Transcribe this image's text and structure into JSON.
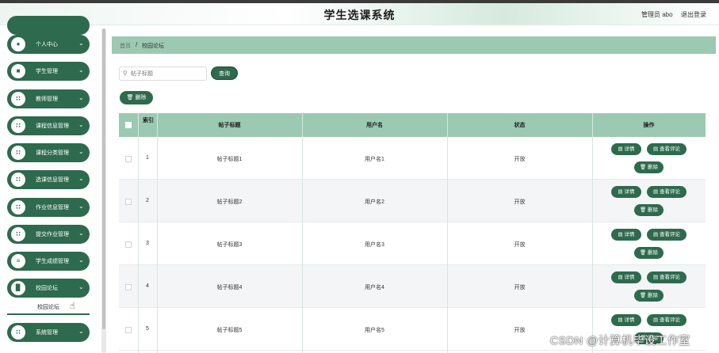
{
  "header": {
    "title": "学生选课系统",
    "admin_label": "管理员 abo",
    "logout_label": "退出登录"
  },
  "sidebar": {
    "items": [
      {
        "label": "个人中心",
        "icon": "user-icon"
      },
      {
        "label": "学生管理",
        "icon": "document-icon"
      },
      {
        "label": "教师管理",
        "icon": "grid-icon"
      },
      {
        "label": "课程信息管理",
        "icon": "grid-icon"
      },
      {
        "label": "课程分类管理",
        "icon": "grid-icon"
      },
      {
        "label": "选课信息管理",
        "icon": "grid-icon"
      },
      {
        "label": "作业信息管理",
        "icon": "grid-icon"
      },
      {
        "label": "提交作业管理",
        "icon": "grid-icon"
      },
      {
        "label": "学生成绩管理",
        "icon": "list-icon"
      },
      {
        "label": "校园论坛",
        "icon": "bar-chart-icon"
      },
      {
        "label": "系统管理",
        "icon": "grid-icon"
      }
    ],
    "subitem": "校园论坛"
  },
  "breadcrumb": {
    "home": "首页",
    "separator": "/",
    "current": "校园论坛"
  },
  "search": {
    "placeholder": "帖子标题",
    "value": "",
    "query_label": "查询"
  },
  "toolbar": {
    "delete_label": "删除"
  },
  "table": {
    "headers": {
      "index": "索引",
      "title": "帖子标题",
      "user": "用户名",
      "status": "状态",
      "actions": "操作"
    },
    "rows": [
      {
        "index": "1",
        "title": "帖子标题1",
        "user": "用户名1",
        "status": "开放"
      },
      {
        "index": "2",
        "title": "帖子标题2",
        "user": "用户名2",
        "status": "开放"
      },
      {
        "index": "3",
        "title": "帖子标题3",
        "user": "用户名3",
        "status": "开放"
      },
      {
        "index": "4",
        "title": "帖子标题4",
        "user": "用户名4",
        "status": "开放"
      },
      {
        "index": "5",
        "title": "帖子标题5",
        "user": "用户名5",
        "status": "开放"
      }
    ],
    "actions": {
      "detail": "详情",
      "comments": "查看评论",
      "delete": "删除"
    }
  },
  "watermark": "CSDN @计算机毕设工作室",
  "colors": {
    "primary": "#2e6a4d",
    "accent": "#9cc9b2"
  }
}
